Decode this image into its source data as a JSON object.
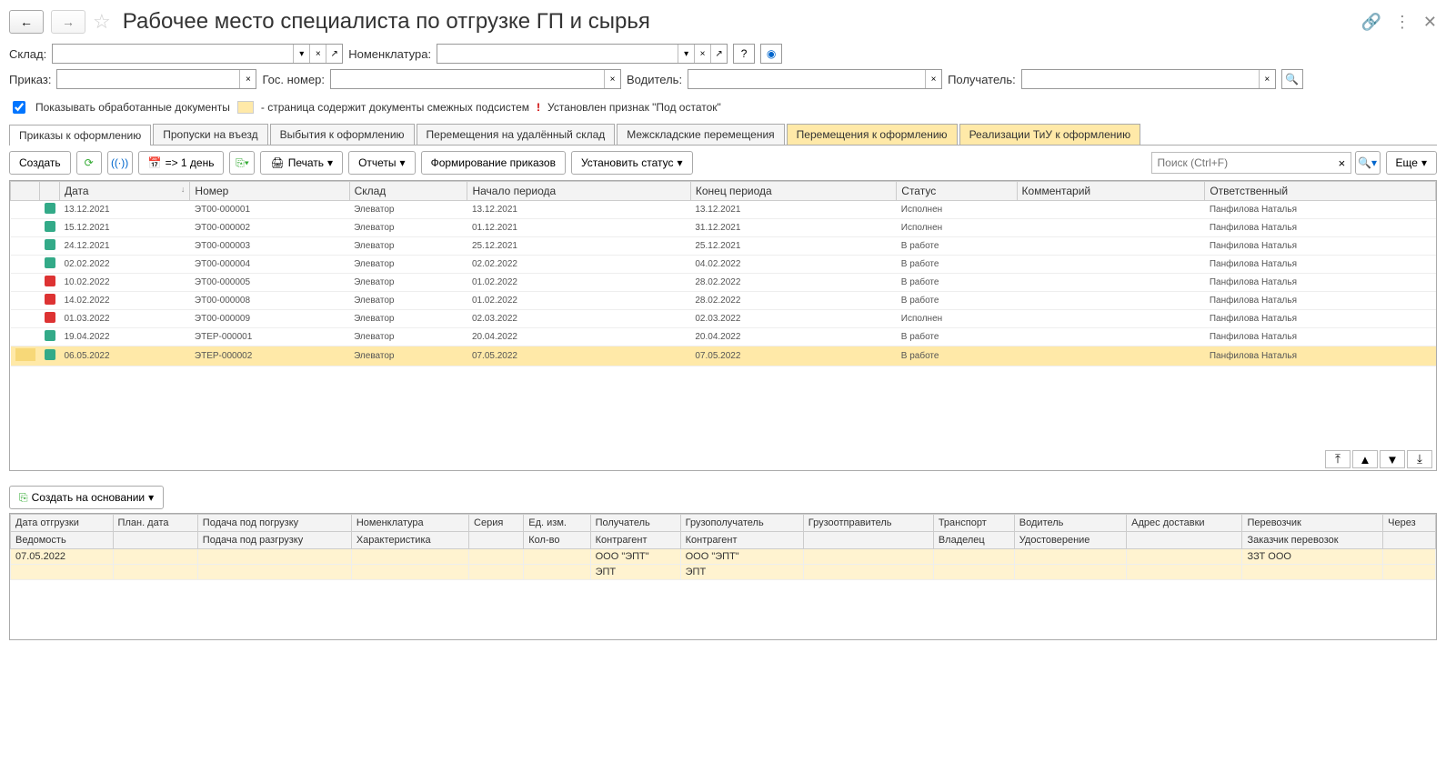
{
  "header": {
    "title": "Рабочее место специалиста по отгрузке ГП и сырья"
  },
  "filters": {
    "warehouse_label": "Склад:",
    "nomenclature_label": "Номенклатура:",
    "order_label": "Приказ:",
    "plate_label": "Гос. номер:",
    "driver_label": "Водитель:",
    "recipient_label": "Получатель:",
    "help_label": "?",
    "show_processed_label": "Показывать обработанные документы",
    "legend_yellow": "- страница содержит документы смежных подсистем",
    "legend_red_mark": "!",
    "legend_red": "Установлен признак \"Под остаток\""
  },
  "tabs": [
    {
      "label": "Приказы к оформлению",
      "active": true
    },
    {
      "label": "Пропуски на въезд"
    },
    {
      "label": "Выбытия к оформлению"
    },
    {
      "label": "Перемещения на удалённый склад"
    },
    {
      "label": "Межскладские перемещения"
    },
    {
      "label": "Перемещения к оформлению",
      "hl": true
    },
    {
      "label": "Реализации ТиУ к оформлению",
      "hl": true
    }
  ],
  "toolbar": {
    "create": "Создать",
    "refresh": "⟳",
    "broadcast": "((∙))",
    "date_shift": "=> 1 день",
    "copy": "⎘",
    "print": "Печать",
    "reports": "Отчеты",
    "form_orders": "Формирование приказов",
    "set_status": "Установить статус",
    "search_placeholder": "Поиск (Ctrl+F)",
    "more": "Еще"
  },
  "grid": {
    "columns": [
      "Дата",
      "Номер",
      "Склад",
      "Начало периода",
      "Конец периода",
      "Статус",
      "Комментарий",
      "Ответственный"
    ],
    "rows": [
      {
        "icon": "done",
        "date": "13.12.2021",
        "num": "ЭТ00-000001",
        "wh": "Элеватор",
        "from": "13.12.2021",
        "to": "13.12.2021",
        "status": "Исполнен",
        "comment": "",
        "resp": "Панфилова Наталья"
      },
      {
        "icon": "done",
        "date": "15.12.2021",
        "num": "ЭТ00-000002",
        "wh": "Элеватор",
        "from": "01.12.2021",
        "to": "31.12.2021",
        "status": "Исполнен",
        "comment": "",
        "resp": "Панфилова Наталья"
      },
      {
        "icon": "work",
        "date": "24.12.2021",
        "num": "ЭТ00-000003",
        "wh": "Элеватор",
        "from": "25.12.2021",
        "to": "25.12.2021",
        "status": "В работе",
        "comment": "",
        "resp": "Панфилова Наталья"
      },
      {
        "icon": "work",
        "date": "02.02.2022",
        "num": "ЭТ00-000004",
        "wh": "Элеватор",
        "from": "02.02.2022",
        "to": "04.02.2022",
        "status": "В работе",
        "comment": "",
        "resp": "Панфилова Наталья"
      },
      {
        "icon": "cancel",
        "date": "10.02.2022",
        "num": "ЭТ00-000005",
        "wh": "Элеватор",
        "from": "01.02.2022",
        "to": "28.02.2022",
        "status": "В работе",
        "comment": "",
        "resp": "Панфилова Наталья"
      },
      {
        "icon": "cancel",
        "date": "14.02.2022",
        "num": "ЭТ00-000008",
        "wh": "Элеватор",
        "from": "01.02.2022",
        "to": "28.02.2022",
        "status": "В работе",
        "comment": "",
        "resp": "Панфилова Наталья"
      },
      {
        "icon": "cancel",
        "date": "01.03.2022",
        "num": "ЭТ00-000009",
        "wh": "Элеватор",
        "from": "02.03.2022",
        "to": "02.03.2022",
        "status": "Исполнен",
        "comment": "",
        "resp": "Панфилова Наталья"
      },
      {
        "icon": "work",
        "date": "19.04.2022",
        "num": "ЭТЕР-000001",
        "wh": "Элеватор",
        "from": "20.04.2022",
        "to": "20.04.2022",
        "status": "В работе",
        "comment": "",
        "resp": "Панфилова Наталья"
      },
      {
        "icon": "work",
        "date": "06.05.2022",
        "num": "ЭТЕР-000002",
        "wh": "Элеватор",
        "from": "07.05.2022",
        "to": "07.05.2022",
        "status": "В работе",
        "comment": "",
        "resp": "Панфилова Наталья",
        "selected": true
      }
    ]
  },
  "sub_toolbar": {
    "create_based": "Создать на основании"
  },
  "detail": {
    "header_r1": [
      "Дата отгрузки",
      "План. дата",
      "Подача под погрузку",
      "Номенклатура",
      "Серия",
      "Ед. изм.",
      "Получатель",
      "Грузополучатель",
      "Грузоотправитель",
      "Транспорт",
      "Водитель",
      "Адрес доставки",
      "Перевозчик",
      "Через"
    ],
    "header_r2": [
      "Ведомость",
      "",
      "Подача под разгрузку",
      "Характеристика",
      "",
      "Кол-во",
      "Контрагент",
      "Контрагент",
      "",
      "Владелец",
      "Удостоверение",
      "",
      "Заказчик перевозок",
      ""
    ],
    "row": {
      "ship_date": "07.05.2022",
      "plan_date": "",
      "load": "",
      "nom": "",
      "series": "",
      "unit": "",
      "recipient": "ООО \"ЭПТ\"",
      "consignee": "ООО \"ЭПТ\"",
      "consignor": "",
      "transport": "",
      "driver": "",
      "addr": "",
      "carrier": "ЗЗТ ООО",
      "via": "",
      "recipient2": "ЭПТ",
      "consignee2": "ЭПТ"
    }
  }
}
